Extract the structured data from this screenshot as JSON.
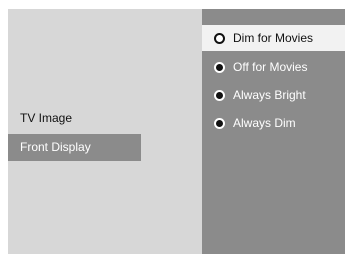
{
  "left_menu": {
    "items": [
      {
        "label": "TV Image"
      },
      {
        "label": "Front Display"
      }
    ]
  },
  "options": {
    "items": [
      {
        "label": "Dim for Movies",
        "selected": true,
        "icon": "radio-selected-icon"
      },
      {
        "label": "Off for Movies",
        "selected": false,
        "icon": "radio-bullet-icon"
      },
      {
        "label": "Always Bright",
        "selected": false,
        "icon": "radio-bullet-icon"
      },
      {
        "label": "Always Dim",
        "selected": false,
        "icon": "radio-bullet-icon"
      }
    ]
  },
  "colors": {
    "background": "#d7d7d7",
    "panel": "#8b8b8b",
    "highlight": "#f2f2f2",
    "text_dark": "#111111",
    "text_light": "#ffffff"
  }
}
